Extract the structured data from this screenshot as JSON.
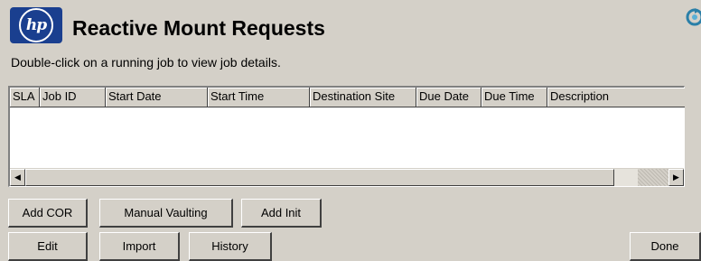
{
  "header": {
    "logo_text": "hp",
    "title": "Reactive Mount Requests",
    "subtitle": "Double-click on a running job to view job details."
  },
  "table": {
    "columns": [
      "SLA",
      "Job ID",
      "Start Date",
      "Start Time",
      "Destination Site",
      "Due Date",
      "Due Time",
      "Description"
    ],
    "rows": []
  },
  "scrollbar": {
    "left_arrow": "◀",
    "right_arrow": "▶"
  },
  "buttons": {
    "add_cor": "Add COR",
    "manual_vaulting": "Manual Vaulting",
    "add_init": "Add Init",
    "edit": "Edit",
    "import": "Import",
    "history": "History",
    "done": "Done"
  },
  "colors": {
    "window_bg": "#d4d0c8",
    "logo_bg": "#1a3f8f",
    "table_bg": "#ffffff"
  }
}
